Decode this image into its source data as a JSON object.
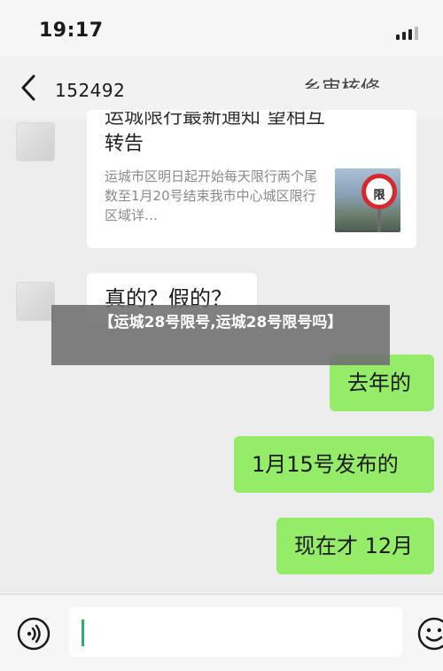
{
  "status_bar": {
    "time": "19:17"
  },
  "nav": {
    "contact": "152492",
    "title_fragment": "...乡审核修"
  },
  "article_card": {
    "title_fragment": "运城限行最新通知 望相互",
    "title_line2": "转告",
    "description": "运城市区明日起开始每天限行两个尾数至1月20号结束我市中心城区限行区域详…",
    "sign_text": "限"
  },
  "messages": [
    {
      "side": "left",
      "text": "真的？假的？"
    },
    {
      "side": "right",
      "text": "去年的"
    },
    {
      "side": "right",
      "text": "1月15号发布的"
    },
    {
      "side": "right",
      "text": "现在才 12月"
    }
  ],
  "overlay": {
    "text": "【运城28号限号,运城28号限号吗】"
  },
  "colors": {
    "sent_bubble": "#95ec69",
    "received_bubble": "#ffffff",
    "background": "#ededed"
  }
}
